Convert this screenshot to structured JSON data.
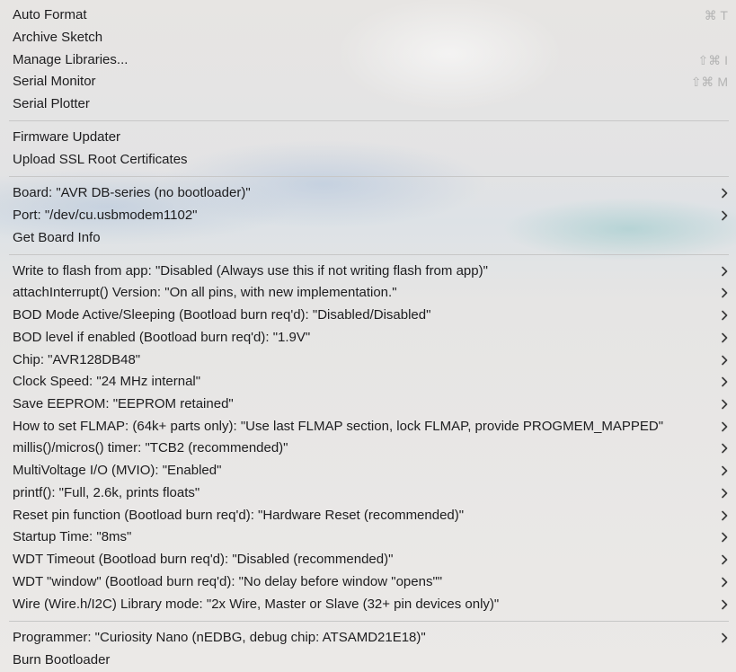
{
  "menu": {
    "group1": [
      {
        "label": "Auto Format",
        "shortcut": "⌘ T"
      },
      {
        "label": "Archive Sketch",
        "shortcut": ""
      },
      {
        "label": "Manage Libraries...",
        "shortcut": "⇧⌘ I"
      },
      {
        "label": "Serial Monitor",
        "shortcut": "⇧⌘ M"
      },
      {
        "label": "Serial Plotter",
        "shortcut": ""
      }
    ],
    "group2": [
      {
        "label": "Firmware Updater"
      },
      {
        "label": "Upload SSL Root Certificates"
      }
    ],
    "group3": [
      {
        "label": "Board: \"AVR DB-series (no bootloader)\"",
        "submenu": true
      },
      {
        "label": "Port: \"/dev/cu.usbmodem1102\"",
        "submenu": true
      },
      {
        "label": "Get Board Info",
        "submenu": false
      }
    ],
    "group4": [
      {
        "label": "Write to flash from app: \"Disabled (Always use this if not writing flash from app)\""
      },
      {
        "label": "attachInterrupt() Version: \"On all pins, with new implementation.\""
      },
      {
        "label": "BOD Mode Active/Sleeping (Bootload burn req'd): \"Disabled/Disabled\""
      },
      {
        "label": "BOD level if enabled (Bootload burn req'd): \"1.9V\""
      },
      {
        "label": "Chip: \"AVR128DB48\""
      },
      {
        "label": "Clock Speed: \"24 MHz internal\""
      },
      {
        "label": "Save EEPROM: \"EEPROM retained\""
      },
      {
        "label": "How to set FLMAP: (64k+ parts only): \"Use last FLMAP section, lock FLMAP, provide PROGMEM_MAPPED\""
      },
      {
        "label": "millis()/micros() timer: \"TCB2 (recommended)\""
      },
      {
        "label": "MultiVoltage I/O (MVIO): \"Enabled\""
      },
      {
        "label": "printf(): \"Full, 2.6k, prints floats\""
      },
      {
        "label": "Reset pin function (Bootload burn req'd): \"Hardware Reset (recommended)\""
      },
      {
        "label": "Startup Time: \"8ms\""
      },
      {
        "label": "WDT Timeout (Bootload burn req'd): \"Disabled (recommended)\""
      },
      {
        "label": "WDT \"window\" (Bootload burn req'd): \"No delay before window \"opens\"\""
      },
      {
        "label": "Wire (Wire.h/I2C) Library mode: \"2x Wire, Master or Slave (32+ pin devices only)\""
      }
    ],
    "group5": [
      {
        "label": "Programmer: \"Curiosity Nano (nEDBG, debug chip: ATSAMD21E18)\"",
        "submenu": true
      },
      {
        "label": "Burn Bootloader",
        "submenu": false
      }
    ]
  }
}
